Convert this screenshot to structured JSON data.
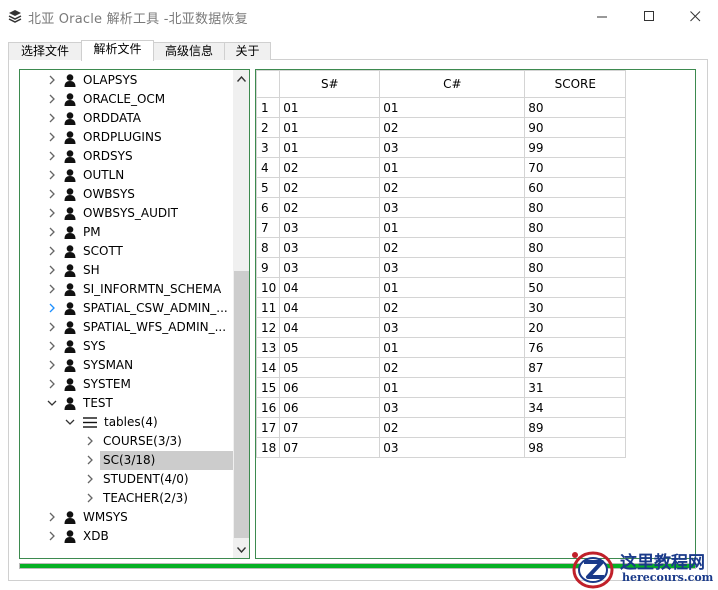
{
  "window": {
    "title": "北亚 Oracle 解析工具  -北亚数据恢复"
  },
  "tabs": [
    {
      "label": "选择文件",
      "active": false
    },
    {
      "label": "解析文件",
      "active": true
    },
    {
      "label": "高级信息",
      "active": false
    },
    {
      "label": "关于",
      "active": false
    }
  ],
  "tree": {
    "items": [
      {
        "label": "OLAPSYS",
        "kind": "user",
        "level": 0,
        "expand": "collapsed",
        "selected": false
      },
      {
        "label": "ORACLE_OCM",
        "kind": "user",
        "level": 0,
        "expand": "collapsed",
        "selected": false
      },
      {
        "label": "ORDDATA",
        "kind": "user",
        "level": 0,
        "expand": "collapsed",
        "selected": false
      },
      {
        "label": "ORDPLUGINS",
        "kind": "user",
        "level": 0,
        "expand": "collapsed",
        "selected": false
      },
      {
        "label": "ORDSYS",
        "kind": "user",
        "level": 0,
        "expand": "collapsed",
        "selected": false
      },
      {
        "label": "OUTLN",
        "kind": "user",
        "level": 0,
        "expand": "collapsed",
        "selected": false
      },
      {
        "label": "OWBSYS",
        "kind": "user",
        "level": 0,
        "expand": "collapsed",
        "selected": false
      },
      {
        "label": "OWBSYS_AUDIT",
        "kind": "user",
        "level": 0,
        "expand": "collapsed",
        "selected": false
      },
      {
        "label": "PM",
        "kind": "user",
        "level": 0,
        "expand": "collapsed",
        "selected": false
      },
      {
        "label": "SCOTT",
        "kind": "user",
        "level": 0,
        "expand": "collapsed",
        "selected": false
      },
      {
        "label": "SH",
        "kind": "user",
        "level": 0,
        "expand": "collapsed",
        "selected": false
      },
      {
        "label": "SI_INFORMTN_SCHEMA",
        "kind": "user",
        "level": 0,
        "expand": "collapsed",
        "selected": false
      },
      {
        "label": "SPATIAL_CSW_ADMIN_...",
        "kind": "user",
        "level": 0,
        "expand": "hover",
        "selected": false
      },
      {
        "label": "SPATIAL_WFS_ADMIN_...",
        "kind": "user",
        "level": 0,
        "expand": "collapsed",
        "selected": false
      },
      {
        "label": "SYS",
        "kind": "user",
        "level": 0,
        "expand": "collapsed",
        "selected": false
      },
      {
        "label": "SYSMAN",
        "kind": "user",
        "level": 0,
        "expand": "collapsed",
        "selected": false
      },
      {
        "label": "SYSTEM",
        "kind": "user",
        "level": 0,
        "expand": "collapsed",
        "selected": false
      },
      {
        "label": "TEST",
        "kind": "user",
        "level": 0,
        "expand": "expanded",
        "selected": false
      },
      {
        "label": "tables(4)",
        "kind": "tables",
        "level": 1,
        "expand": "expanded",
        "selected": false
      },
      {
        "label": "COURSE(3/3)",
        "kind": "table",
        "level": 2,
        "expand": "collapsed",
        "selected": false
      },
      {
        "label": "SC(3/18)",
        "kind": "table",
        "level": 2,
        "expand": "collapsed",
        "selected": true
      },
      {
        "label": "STUDENT(4/0)",
        "kind": "table",
        "level": 2,
        "expand": "collapsed",
        "selected": false
      },
      {
        "label": "TEACHER(2/3)",
        "kind": "table",
        "level": 2,
        "expand": "collapsed",
        "selected": false
      },
      {
        "label": "WMSYS",
        "kind": "user",
        "level": 0,
        "expand": "collapsed",
        "selected": false
      },
      {
        "label": "XDB",
        "kind": "user",
        "level": 0,
        "expand": "collapsed",
        "selected": false
      }
    ]
  },
  "grid": {
    "columns": [
      "",
      "S#",
      "C#",
      "SCORE"
    ],
    "rows": [
      [
        "1",
        "01",
        "01",
        "80"
      ],
      [
        "2",
        "01",
        "02",
        "90"
      ],
      [
        "3",
        "01",
        "03",
        "99"
      ],
      [
        "4",
        "02",
        "01",
        "70"
      ],
      [
        "5",
        "02",
        "02",
        "60"
      ],
      [
        "6",
        "02",
        "03",
        "80"
      ],
      [
        "7",
        "03",
        "01",
        "80"
      ],
      [
        "8",
        "03",
        "02",
        "80"
      ],
      [
        "9",
        "03",
        "03",
        "80"
      ],
      [
        "10",
        "04",
        "01",
        "50"
      ],
      [
        "11",
        "04",
        "02",
        "30"
      ],
      [
        "12",
        "04",
        "03",
        "20"
      ],
      [
        "13",
        "05",
        "01",
        "76"
      ],
      [
        "14",
        "05",
        "02",
        "87"
      ],
      [
        "15",
        "06",
        "01",
        "31"
      ],
      [
        "16",
        "06",
        "03",
        "34"
      ],
      [
        "17",
        "07",
        "02",
        "89"
      ],
      [
        "18",
        "07",
        "03",
        "98"
      ]
    ]
  },
  "progress": {
    "fraction": 1.0,
    "color": "#06b025"
  },
  "watermark": {
    "name_cn": "这里教程网",
    "domain": "herecours.com"
  },
  "colors": {
    "panel_border": "#3d8a4f",
    "selection": "#cccccc",
    "title_text": "#7a7a7a"
  }
}
